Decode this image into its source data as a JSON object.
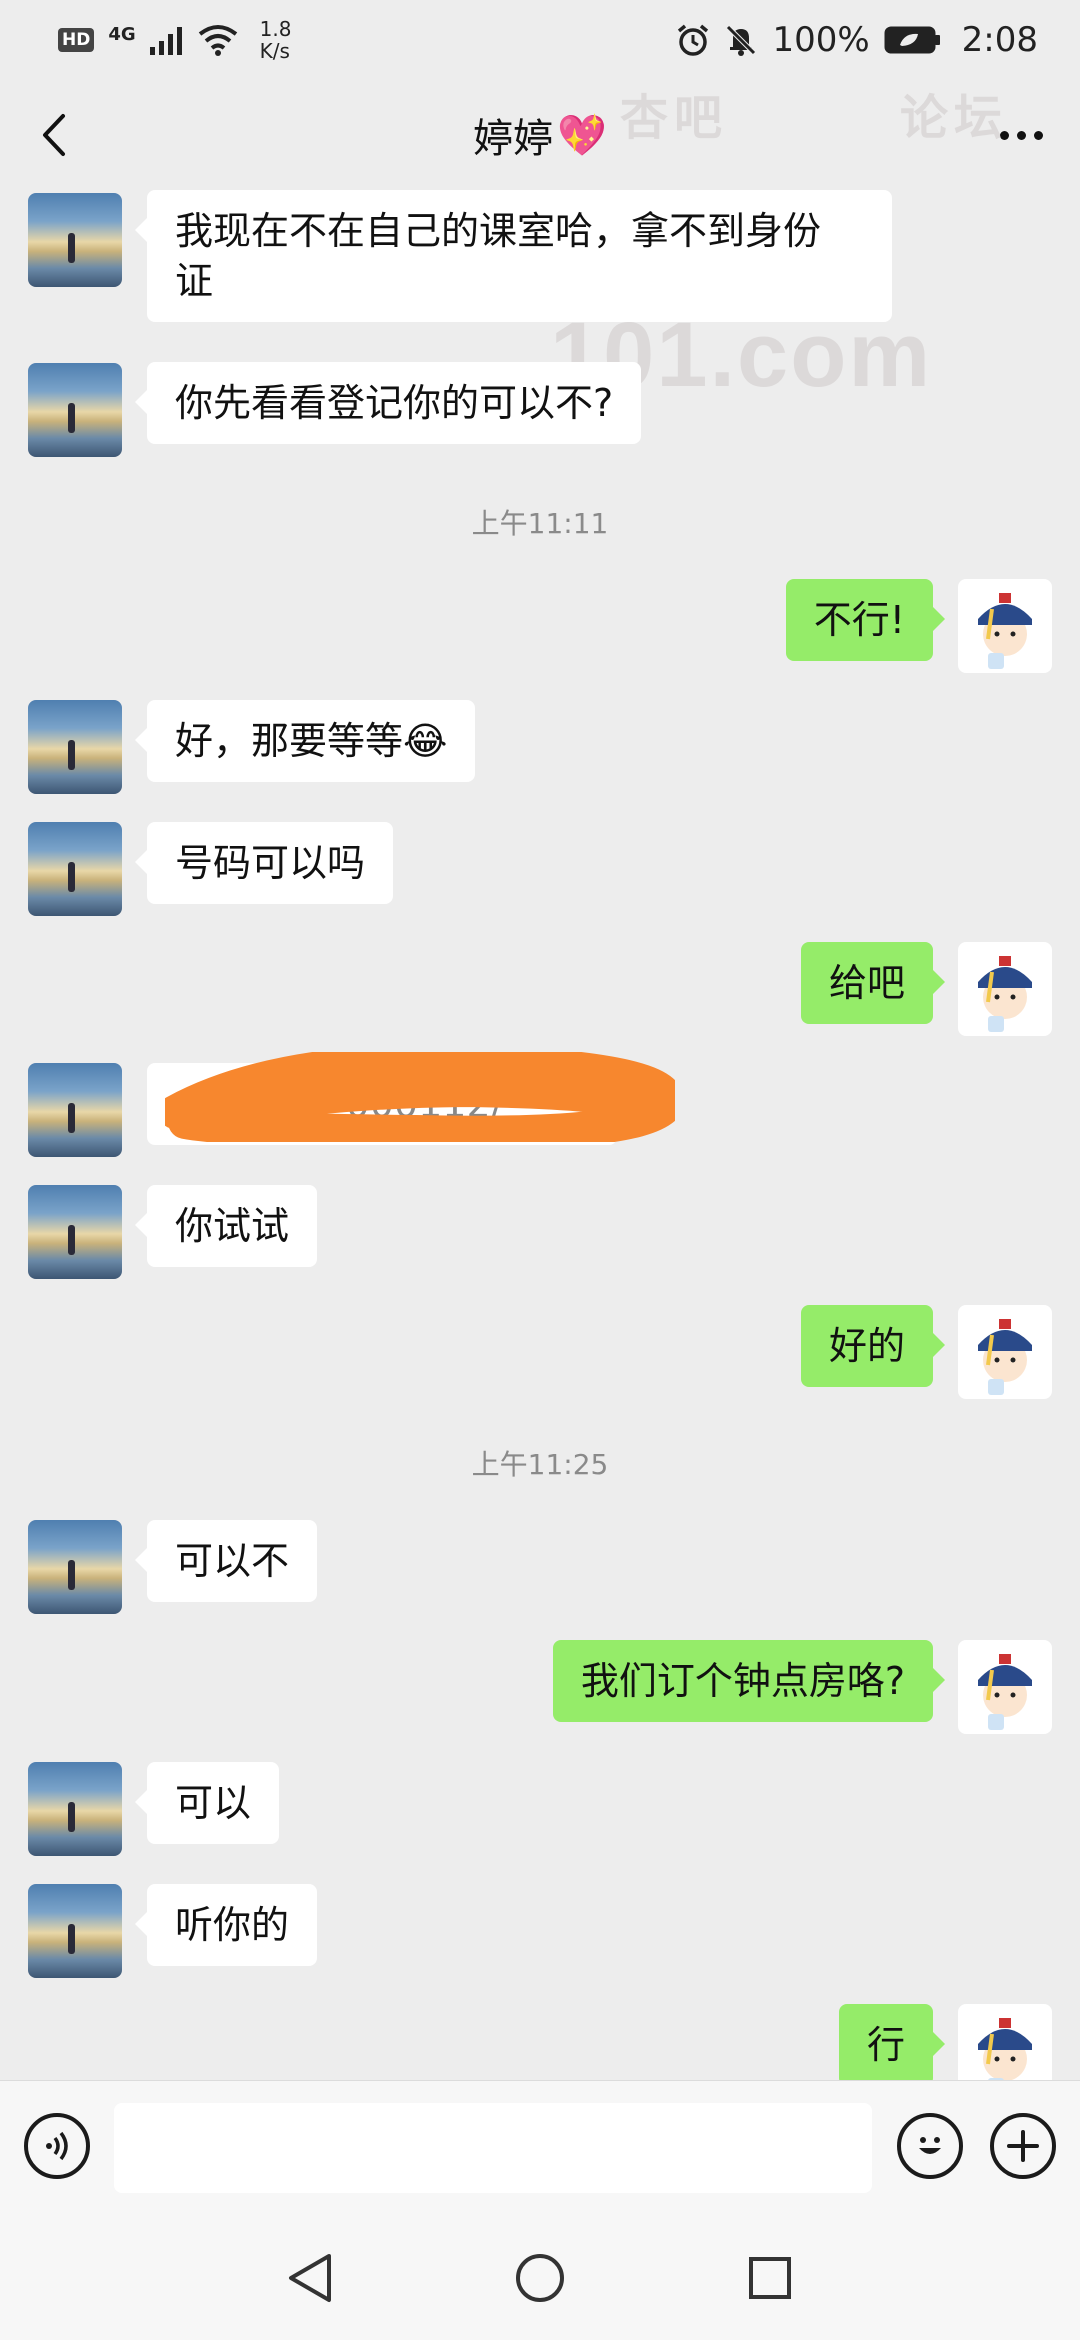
{
  "status_bar": {
    "hd": "HD",
    "network": "4G",
    "speed_value": "1.8",
    "speed_unit": "K/s",
    "battery": "100%",
    "time": "2:08"
  },
  "header": {
    "title": "婷婷",
    "title_emoji": "💖"
  },
  "watermark": {
    "top_left": "杏吧",
    "top_right": "论坛",
    "main": "回家101.com"
  },
  "messages": [
    {
      "side": "left",
      "text_line1": "我现在不在自己的课室哈，拿不到身份",
      "text_line2": "证"
    },
    {
      "side": "left",
      "text": "你先看看登记你的可以不?"
    },
    {
      "type": "time",
      "text": "上午11:11"
    },
    {
      "side": "right",
      "text": "不行!"
    },
    {
      "side": "left",
      "text": "好，那要等等",
      "emoji": "😂"
    },
    {
      "side": "left",
      "text": "号码可以吗"
    },
    {
      "side": "right",
      "text": "给吧"
    },
    {
      "side": "left",
      "text": "//0··········000112/",
      "redacted": true
    },
    {
      "side": "left",
      "text": "你试试"
    },
    {
      "side": "right",
      "text": "好的"
    },
    {
      "type": "time",
      "text": "上午11:25"
    },
    {
      "side": "left",
      "text": "可以不"
    },
    {
      "side": "right",
      "text": "我们订个钟点房咯?"
    },
    {
      "side": "left",
      "text": "可以"
    },
    {
      "side": "left",
      "text": "听你的"
    },
    {
      "side": "right",
      "text": "行"
    }
  ],
  "input": {
    "value": ""
  },
  "colors": {
    "background": "#ededed",
    "self_bubble": "#95ec69",
    "friend_bubble": "#ffffff",
    "redaction": "#f7872e"
  },
  "icons": {
    "voice": "voice-icon",
    "emoji": "emoji-icon",
    "plus": "plus-icon",
    "back": "chevron-left-icon",
    "more": "more-dots-icon"
  }
}
